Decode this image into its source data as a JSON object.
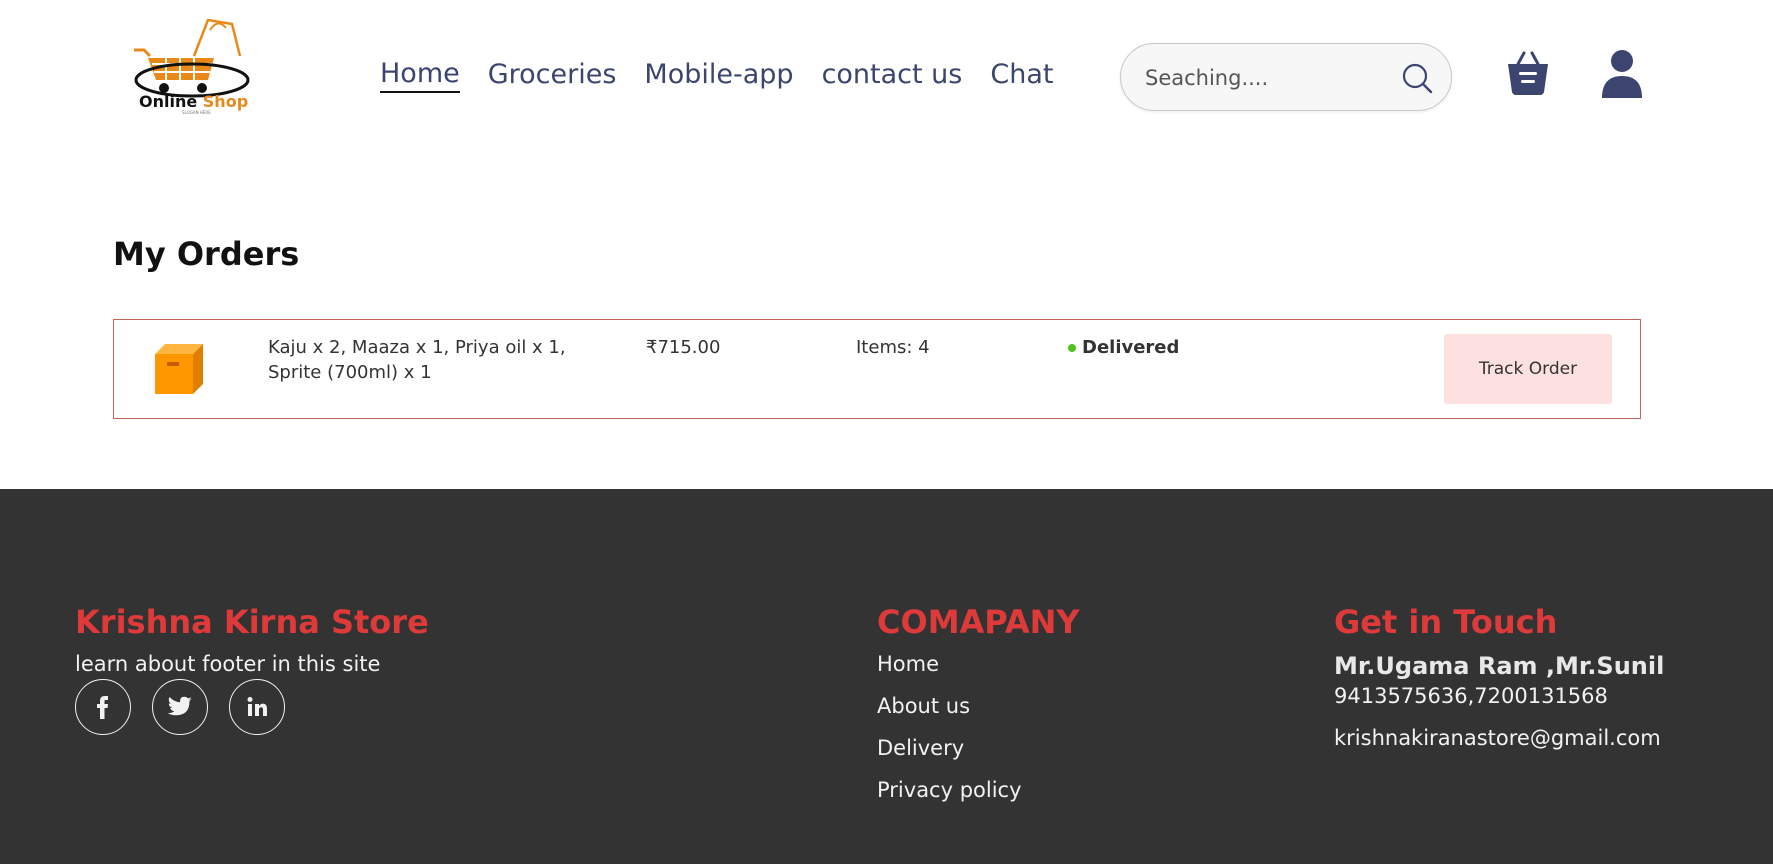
{
  "header": {
    "logo": {
      "text_main": "Online",
      "text_accent": "Shop",
      "tagline": "SLOGAN HERE"
    },
    "nav": [
      {
        "label": "Home",
        "active": true
      },
      {
        "label": "Groceries",
        "active": false
      },
      {
        "label": "Mobile-app",
        "active": false
      },
      {
        "label": "contact us",
        "active": false
      },
      {
        "label": "Chat",
        "active": false
      }
    ],
    "search": {
      "placeholder": "Seaching....",
      "value": ""
    },
    "icons": {
      "search": "search-icon",
      "cart": "cart-basket-icon",
      "user": "user-icon"
    }
  },
  "main": {
    "title": "My Orders",
    "orders": [
      {
        "icon": "box-icon",
        "items": "Kaju x 2, Maaza x 1, Priya oil x 1, Sprite (700ml) x 1",
        "price": "₹715.00",
        "count": "Items: 4",
        "status": "Delivered",
        "action": "Track Order"
      }
    ]
  },
  "footer": {
    "brand": {
      "title": "Krishna Kirna Store",
      "tagline": "learn about footer in this site",
      "social": [
        "facebook-icon",
        "twitter-icon",
        "linkedin-icon"
      ]
    },
    "company": {
      "title": "COMAPANY",
      "links": [
        "Home",
        "About us",
        "Delivery",
        "Privacy policy"
      ]
    },
    "contact": {
      "title": "Get in Touch",
      "names": "Mr.Ugama Ram ,Mr.Sunil",
      "phones": "9413575636,7200131568",
      "email": "krishnakiranastore@gmail.com"
    }
  },
  "colors": {
    "nav_text": "#3b4570",
    "accent_red": "#de3a3a",
    "footer_bg": "#333333",
    "status_green": "#4cc51b",
    "track_btn_bg": "#fde0e0",
    "card_border": "#c0665a",
    "logo_orange": "#e8891a"
  }
}
